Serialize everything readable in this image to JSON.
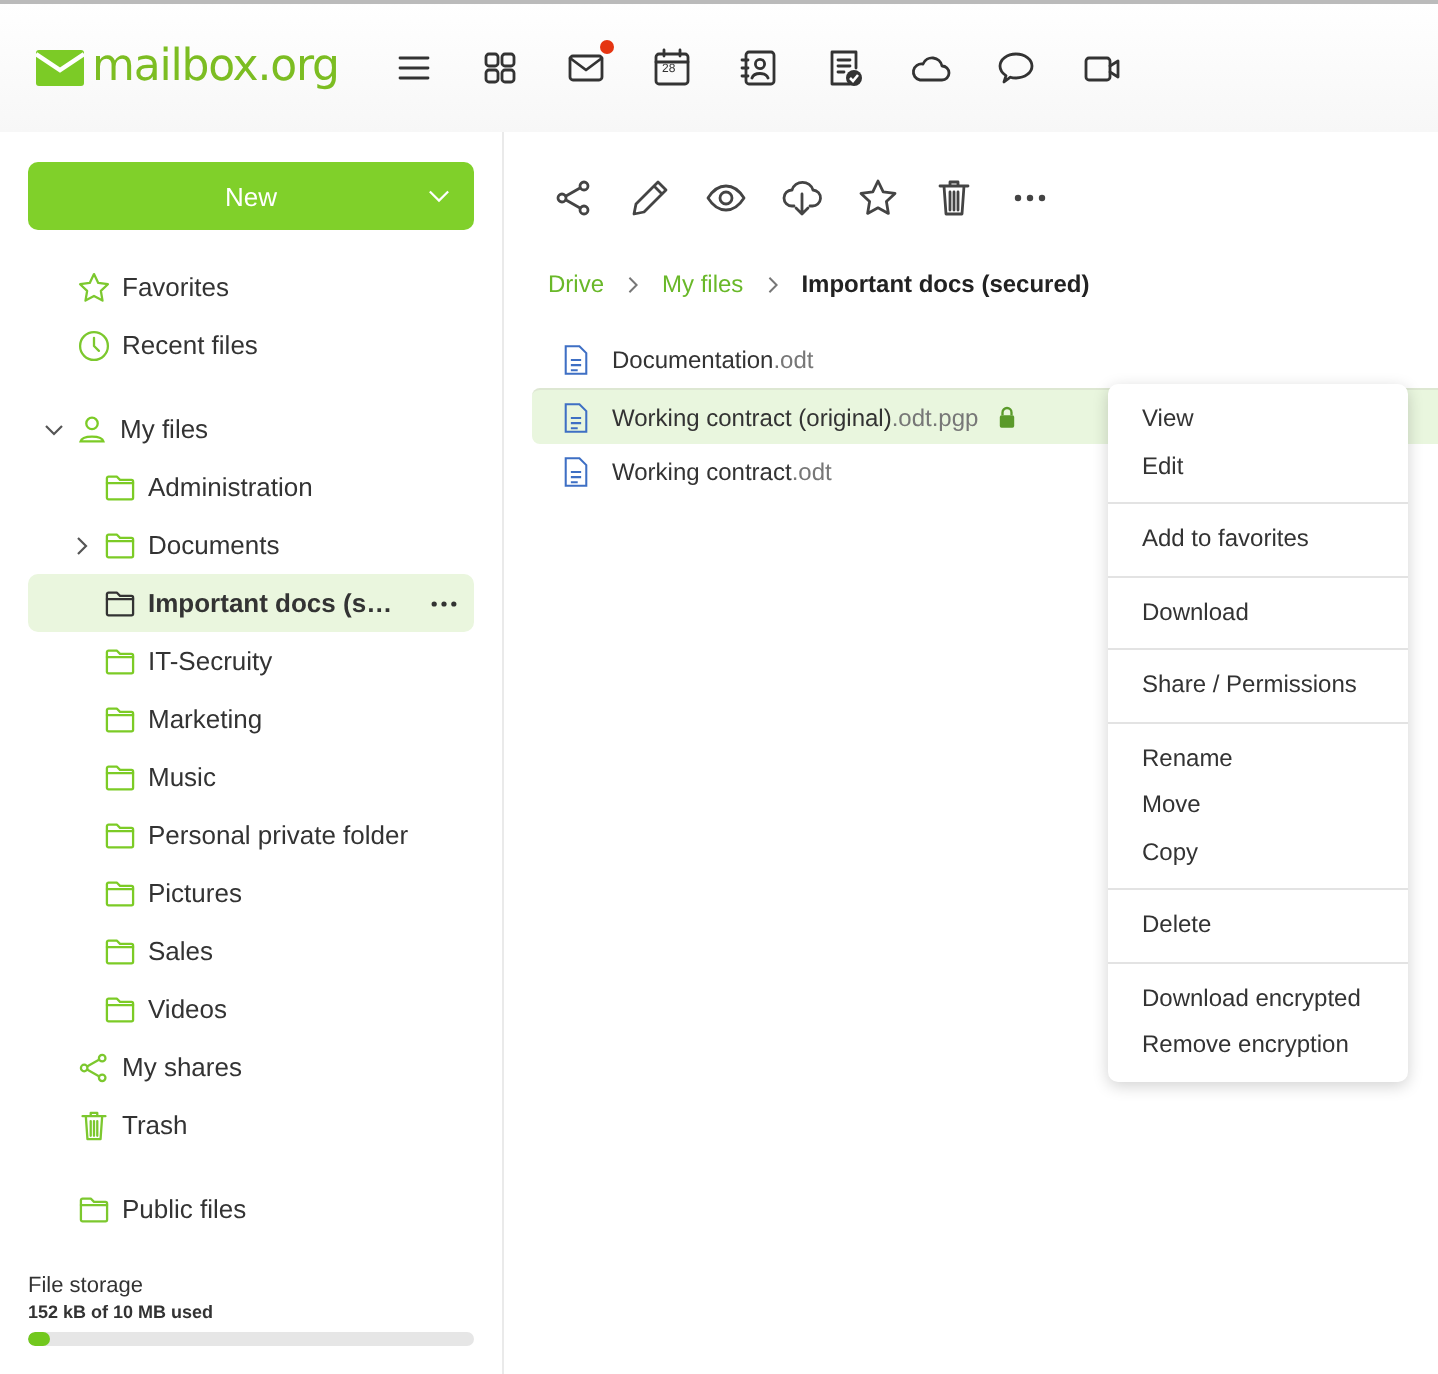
{
  "header": {
    "logo": "mailbox.org",
    "apps": [
      {
        "kind": "menu",
        "notification": false
      },
      {
        "kind": "apps",
        "notification": false
      },
      {
        "kind": "mail",
        "notification": true
      },
      {
        "kind": "calendar",
        "day": "28",
        "notification": false
      },
      {
        "kind": "contacts",
        "notification": false
      },
      {
        "kind": "tasks",
        "notification": false
      },
      {
        "kind": "cloud",
        "notification": false
      },
      {
        "kind": "chat",
        "notification": false
      },
      {
        "kind": "video",
        "notification": false
      }
    ]
  },
  "sidebar": {
    "new_button": "New",
    "top_items": [
      {
        "kind": "star",
        "label": "Favorites"
      },
      {
        "kind": "clock",
        "label": "Recent files"
      }
    ],
    "my_files": {
      "label": "My files",
      "expanded": true,
      "children": [
        {
          "label": "Administration",
          "expandable": false,
          "selected": false
        },
        {
          "label": "Documents",
          "expandable": true,
          "selected": false
        },
        {
          "label": "Important docs (s…",
          "expandable": false,
          "selected": true
        },
        {
          "label": "IT-Secruity",
          "expandable": false,
          "selected": false
        },
        {
          "label": "Marketing",
          "expandable": false,
          "selected": false
        },
        {
          "label": "Music",
          "expandable": false,
          "selected": false
        },
        {
          "label": "Personal private folder",
          "expandable": false,
          "selected": false
        },
        {
          "label": "Pictures",
          "expandable": false,
          "selected": false
        },
        {
          "label": "Sales",
          "expandable": false,
          "selected": false
        },
        {
          "label": "Videos",
          "expandable": false,
          "selected": false
        }
      ]
    },
    "bottom_items": [
      {
        "kind": "share",
        "label": "My shares"
      },
      {
        "kind": "trash",
        "label": "Trash"
      }
    ],
    "public_item": {
      "kind": "folder",
      "label": "Public files"
    },
    "storage": {
      "title": "File storage",
      "usage": "152 kB of 10 MB used",
      "level": 0.05
    }
  },
  "toolbar": [
    {
      "kind": "share"
    },
    {
      "kind": "pencil"
    },
    {
      "kind": "eye"
    },
    {
      "kind": "download"
    },
    {
      "kind": "star"
    },
    {
      "kind": "trash"
    },
    {
      "kind": "more"
    }
  ],
  "breadcrumb": [
    "Drive",
    "My files",
    "Important docs (secured)"
  ],
  "files": [
    {
      "name": "Documentation",
      "ext": ".odt",
      "locked": false,
      "selected": false
    },
    {
      "name": "Working contract (original)",
      "ext": ".odt.pgp",
      "locked": true,
      "selected": true
    },
    {
      "name": "Working contract",
      "ext": ".odt",
      "locked": false,
      "selected": false
    }
  ],
  "context_menu": [
    [
      "View",
      "Edit"
    ],
    [
      "Add to favorites"
    ],
    [
      "Download"
    ],
    [
      "Share / Permissions"
    ],
    [
      "Rename",
      "Move",
      "Copy"
    ],
    [
      "Delete"
    ],
    [
      "Download encrypted",
      "Remove encryption"
    ]
  ]
}
